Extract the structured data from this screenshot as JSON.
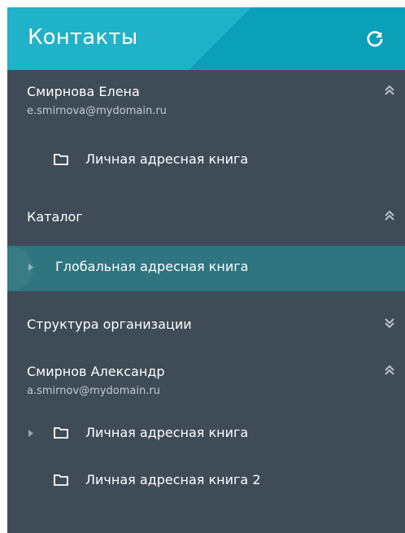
{
  "header": {
    "title": "Контакты",
    "refresh_icon": "refresh-icon"
  },
  "accounts": [
    {
      "name": "Смирнова Елена",
      "email": "e.smirnova@mydomain.ru",
      "expanded": true,
      "items": [
        {
          "label": "Личная адресная книга"
        }
      ]
    },
    {
      "name": "Каталог",
      "expanded": true,
      "items": [
        {
          "label": "Глобальная адресная книга",
          "active": true
        }
      ]
    },
    {
      "name": "Структура организации",
      "expanded": false,
      "items": []
    },
    {
      "name": "Смирнов Александр",
      "email": "a.smirnov@mydomain.ru",
      "expanded": true,
      "items": [
        {
          "label": "Личная адресная книга",
          "has_children": true
        },
        {
          "label": "Личная адресная книга 2"
        }
      ]
    }
  ],
  "colors": {
    "panel_bg": "#3f4b57",
    "header_bg": "#0aa0b8",
    "header_shade": "#20b2c9",
    "active_bg": "#2e7580",
    "email_text": "#c3cbd3"
  }
}
